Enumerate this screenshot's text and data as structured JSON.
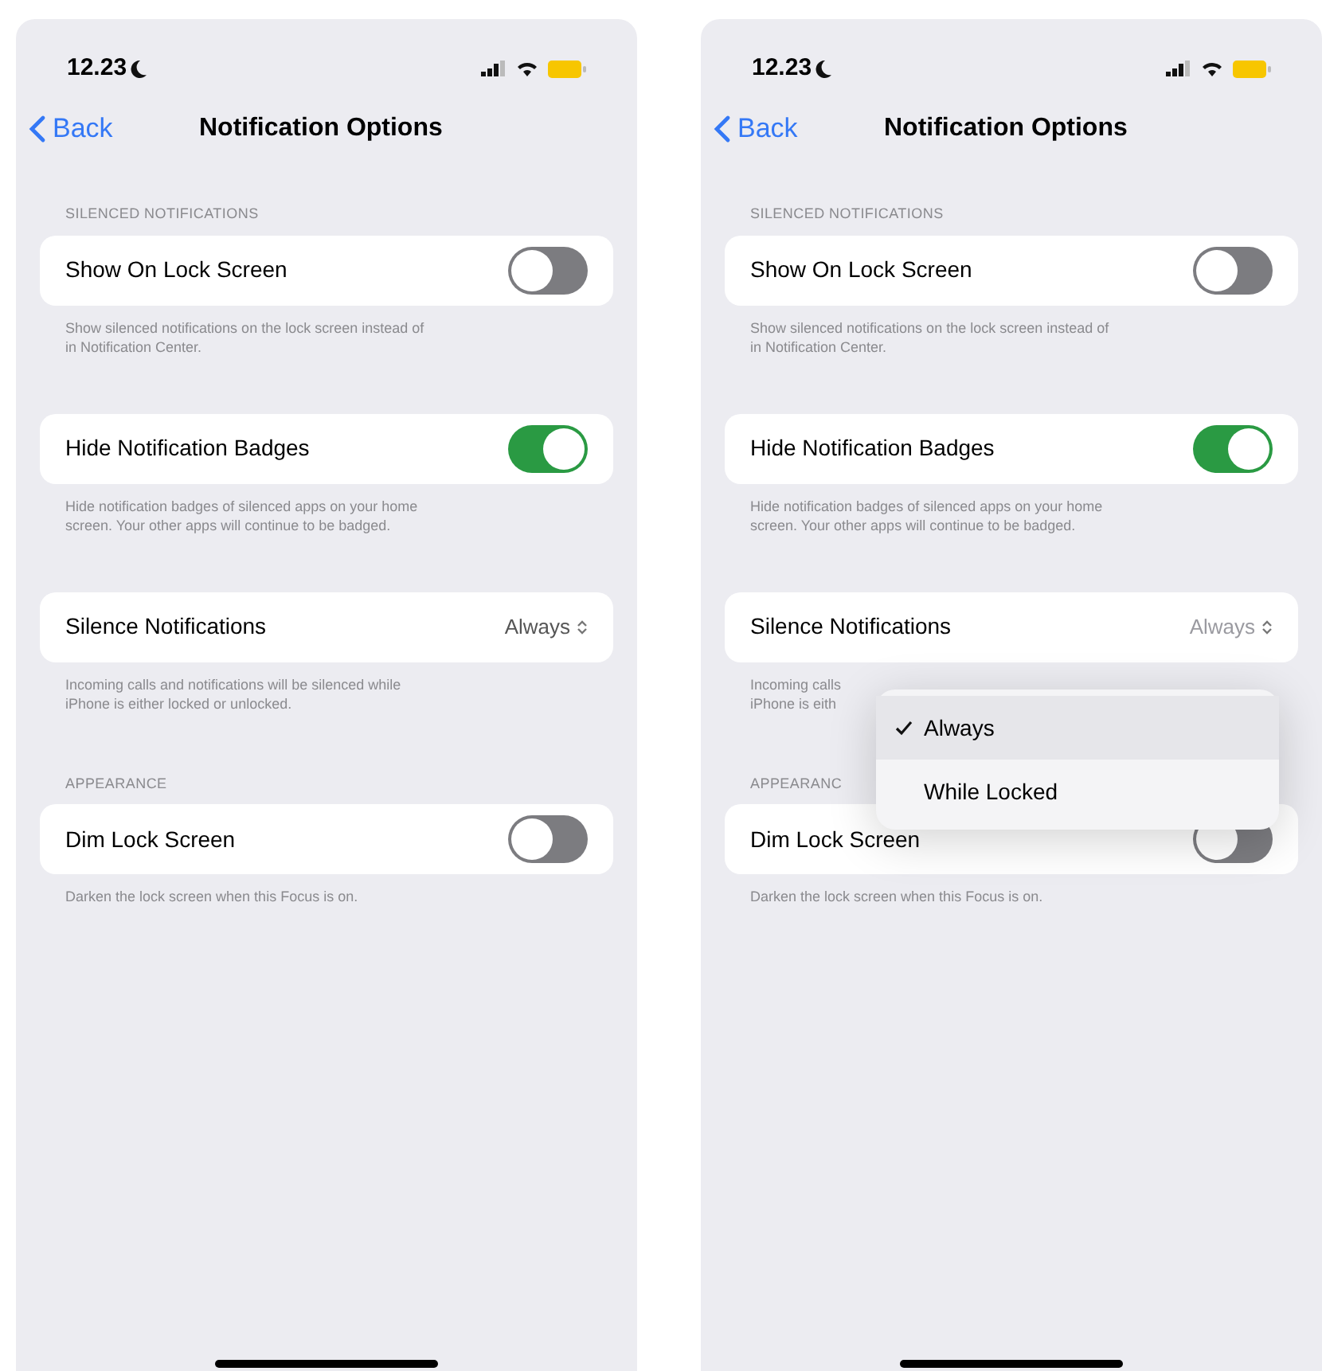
{
  "screens": [
    {
      "status_bar": {
        "time": "12.23"
      },
      "nav": {
        "back": "Back",
        "title": "Notification Options"
      },
      "sections": [
        {
          "header": "SILENCED NOTIFICATIONS",
          "rows": [
            {
              "kind": "toggle",
              "label": "Show On Lock Screen",
              "on": false
            }
          ],
          "footer": [
            "Show silenced notifications on the lock screen instead of",
            "in Notification Center."
          ]
        },
        {
          "rows": [
            {
              "kind": "toggle",
              "label": "Hide Notification Badges",
              "on": true
            }
          ],
          "footer": [
            "Hide notification badges of silenced apps on your home",
            "screen. Your other apps will continue to be badged."
          ]
        },
        {
          "rows": [
            {
              "kind": "value",
              "label": "Silence Notifications",
              "value": "Always"
            }
          ],
          "footer": [
            "Incoming calls and notifications will be silenced while",
            "iPhone is either locked or unlocked."
          ]
        },
        {
          "header": "APPEARANCE",
          "rows": [
            {
              "kind": "toggle",
              "label": "Dim Lock Screen",
              "on": false
            }
          ],
          "footer": [
            "Darken the lock screen when this Focus is on."
          ]
        }
      ]
    },
    {
      "status_bar": {
        "time": "12.23"
      },
      "nav": {
        "back": "Back",
        "title": "Notification Options"
      },
      "sections": [
        {
          "header": "SILENCED NOTIFICATIONS",
          "rows": [
            {
              "kind": "toggle",
              "label": "Show On Lock Screen",
              "on": false
            }
          ],
          "footer": [
            "Show silenced notifications on the lock screen instead of",
            "in Notification Center."
          ]
        },
        {
          "rows": [
            {
              "kind": "toggle",
              "label": "Hide Notification Badges",
              "on": true
            }
          ],
          "footer": [
            "Hide notification badges of silenced apps on your home",
            "screen. Your other apps will continue to be badged."
          ]
        },
        {
          "rows": [
            {
              "kind": "value",
              "label": "Silence Notifications",
              "value": "Always"
            }
          ],
          "footer": [
            "Incoming calls",
            "iPhone is eith"
          ]
        },
        {
          "header": "APPEARANC",
          "rows": [
            {
              "kind": "toggle",
              "label": "Dim Lock Screen",
              "on": false
            }
          ],
          "footer": [
            "Darken the lock screen when this Focus is on."
          ]
        }
      ],
      "menu": {
        "items": [
          {
            "label": "Always",
            "selected": true
          },
          {
            "label": "While Locked",
            "selected": false
          }
        ]
      }
    }
  ]
}
